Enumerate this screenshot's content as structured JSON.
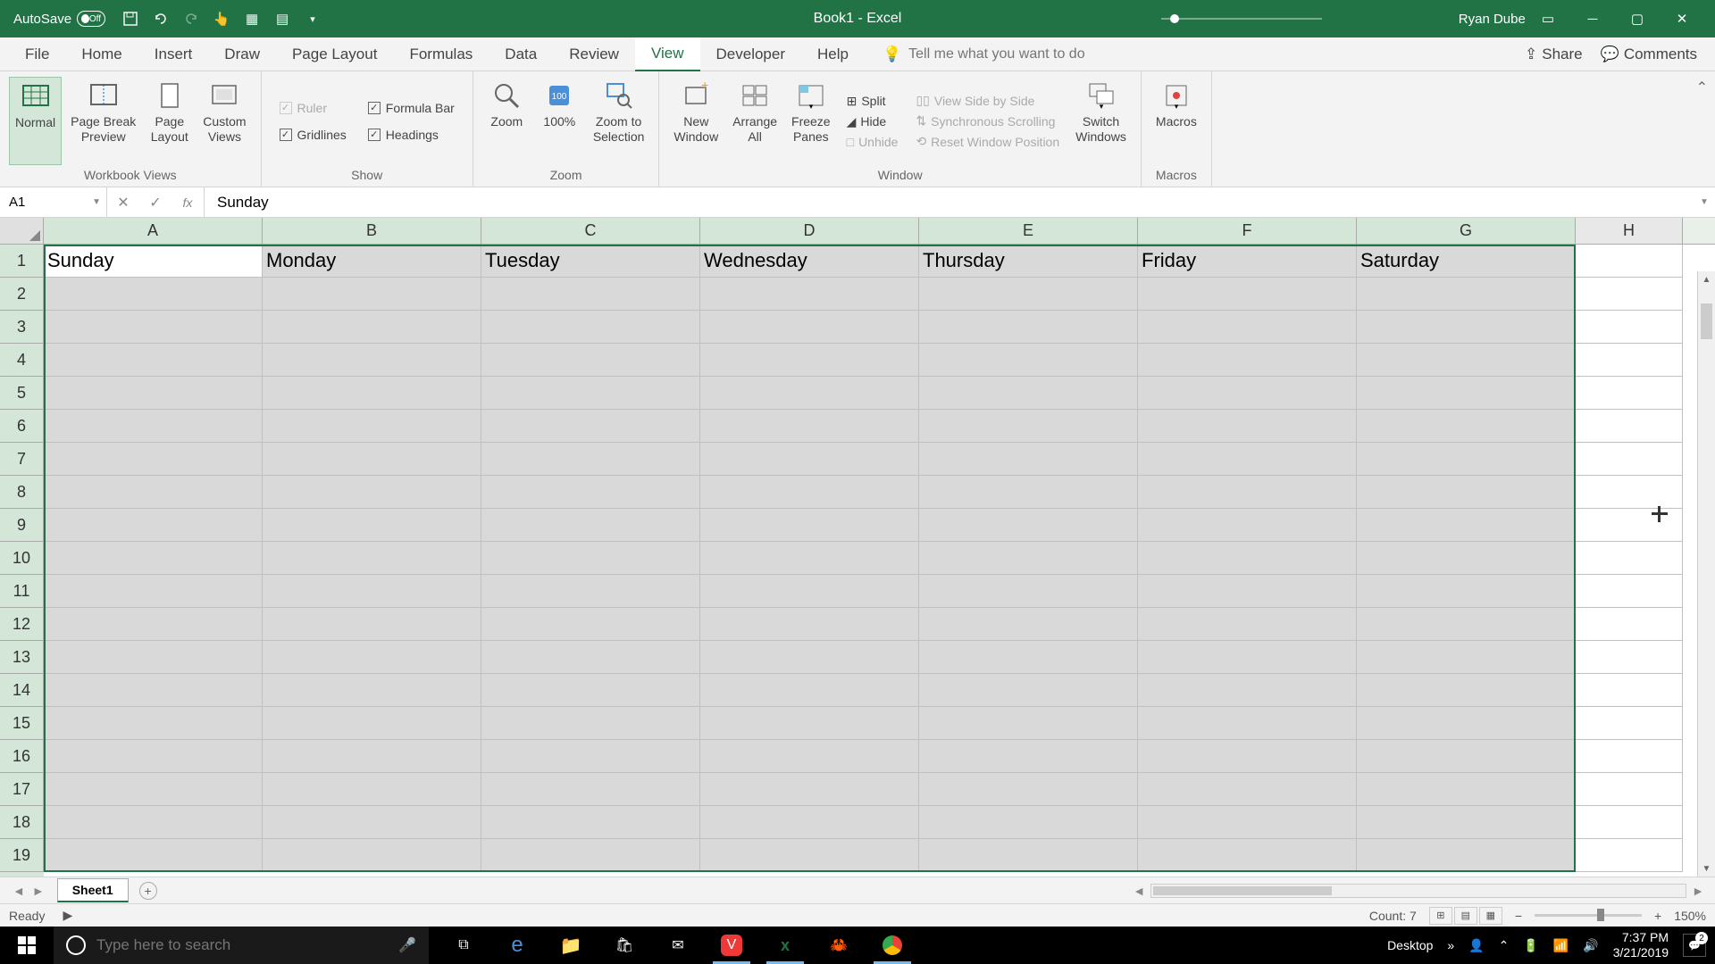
{
  "titlebar": {
    "autosave_label": "AutoSave",
    "autosave_state": "Off",
    "title": "Book1 - Excel",
    "username": "Ryan Dube"
  },
  "tabs": [
    "File",
    "Home",
    "Insert",
    "Draw",
    "Page Layout",
    "Formulas",
    "Data",
    "Review",
    "View",
    "Developer",
    "Help"
  ],
  "active_tab": "View",
  "tellme_placeholder": "Tell me what you want to do",
  "share_label": "Share",
  "comments_label": "Comments",
  "ribbon": {
    "workbook_views": {
      "label": "Workbook Views",
      "normal": "Normal",
      "page_break": "Page Break\nPreview",
      "page_layout": "Page\nLayout",
      "custom_views": "Custom\nViews"
    },
    "show": {
      "label": "Show",
      "ruler": "Ruler",
      "formula_bar": "Formula Bar",
      "gridlines": "Gridlines",
      "headings": "Headings"
    },
    "zoom": {
      "label": "Zoom",
      "zoom": "Zoom",
      "hundred": "100%",
      "to_selection": "Zoom to\nSelection"
    },
    "window": {
      "label": "Window",
      "new_window": "New\nWindow",
      "arrange_all": "Arrange\nAll",
      "freeze_panes": "Freeze\nPanes",
      "split": "Split",
      "hide": "Hide",
      "unhide": "Unhide",
      "side_by_side": "View Side by Side",
      "sync_scroll": "Synchronous Scrolling",
      "reset_pos": "Reset Window Position",
      "switch": "Switch\nWindows"
    },
    "macros": {
      "label": "Macros",
      "macros": "Macros"
    }
  },
  "name_box": "A1",
  "formula_value": "Sunday",
  "columns": [
    "A",
    "B",
    "C",
    "D",
    "E",
    "F",
    "G",
    "H"
  ],
  "rows": [
    1,
    2,
    3,
    4,
    5,
    6,
    7,
    8,
    9,
    10,
    11,
    12,
    13,
    14,
    15,
    16,
    17,
    18,
    19
  ],
  "row1_data": [
    "Sunday",
    "Monday",
    "Tuesday",
    "Wednesday",
    "Thursday",
    "Friday",
    "Saturday"
  ],
  "sheet_name": "Sheet1",
  "status": {
    "ready": "Ready",
    "count": "Count: 7",
    "zoom": "150%"
  },
  "taskbar": {
    "search_placeholder": "Type here to search",
    "desktop": "Desktop",
    "time": "7:37 PM",
    "date": "3/21/2019",
    "notif_count": "2"
  }
}
